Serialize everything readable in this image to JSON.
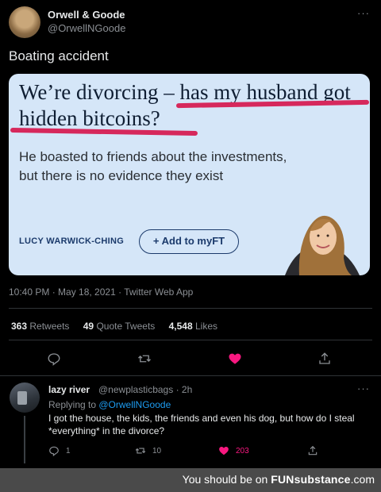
{
  "tweet": {
    "display_name": "Orwell & Goode",
    "handle": "@OrwellNGoode",
    "text": "Boating accident",
    "more_glyph": "···",
    "card": {
      "headline": "We’re divorcing – has my husband got hidden bitcoins?",
      "standfirst": "He boasted to friends about the investments, but there is no evidence they exist",
      "author": "LUCY WARWICK-CHING",
      "add_button": "+ Add to myFT",
      "underline_color": "#d6285c",
      "background": "#d5e6f8"
    },
    "timestamp": "10:40 PM · May 18, 2021 · Twitter Web App",
    "stats": {
      "retweets_count": "363",
      "retweets_label": "Retweets",
      "quotes_count": "49",
      "quotes_label": "Quote Tweets",
      "likes_count": "4,548",
      "likes_label": "Likes"
    },
    "actions": [
      "reply-icon",
      "retweet-icon",
      "like-icon",
      "share-icon"
    ],
    "like_color": "#f91880"
  },
  "reply": {
    "display_name": "lazy river",
    "handle_time": "@newplasticbags · 2h",
    "replying_prefix": "Replying to ",
    "replying_to": "@OrwellNGoode",
    "text": "I got the house, the kids, the friends and even his dog, but how do I steal *everything* in the divorce?",
    "reply_count": "1",
    "retweet_count": "10",
    "like_count": "203",
    "more_glyph": "···"
  },
  "watermark": {
    "prefix": "You should be on ",
    "brand": "FUNsubstance",
    "suffix": ".com"
  }
}
